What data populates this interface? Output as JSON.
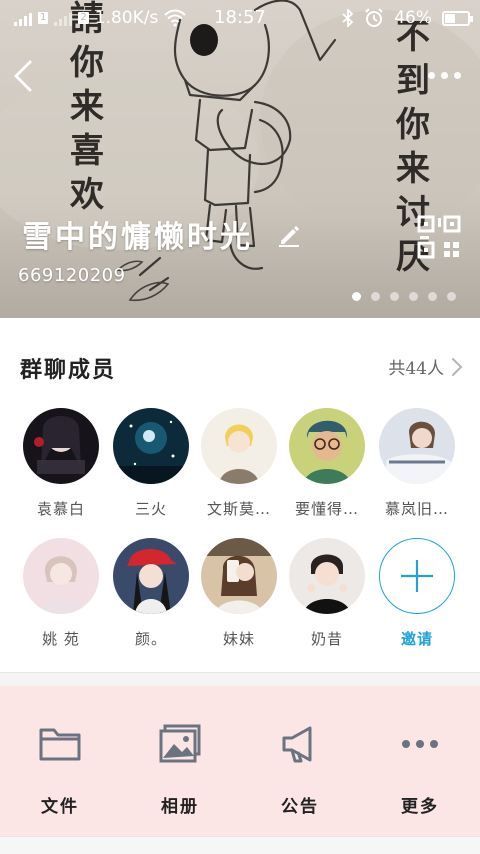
{
  "status_bar": {
    "network_speed": "1.80K/s",
    "time": "18:57",
    "battery": "46%",
    "battery_level": 0.46,
    "sim1": "1",
    "sim2": "2"
  },
  "header": {
    "group_name": "雪中的慵懒时光",
    "group_id": "669120209",
    "banner_pages": 6,
    "active_page": 0,
    "wall_text_left": "請你来喜欢",
    "wall_text_right": "不到你来讨厌"
  },
  "members": {
    "title": "群聊成员",
    "count_label": "共44人",
    "list": [
      {
        "name": "袁慕白",
        "avatar": "avatar-anime-girl-dark"
      },
      {
        "name": "三火",
        "avatar": "avatar-starry-sky"
      },
      {
        "name": "文斯莫…",
        "avatar": "avatar-anime-boy-blonde"
      },
      {
        "name": "要懂得…",
        "avatar": "avatar-painted-boy-glasses"
      },
      {
        "name": "慕岚旧…",
        "avatar": "avatar-girl-resting"
      },
      {
        "name": "姚 苑",
        "avatar": "avatar-girl-soft"
      },
      {
        "name": "颜。",
        "avatar": "avatar-girl-red-cap"
      },
      {
        "name": "妹妹",
        "avatar": "avatar-girl-phone"
      },
      {
        "name": "奶昔",
        "avatar": "avatar-child-peace"
      }
    ],
    "invite_label": "邀请"
  },
  "actions": [
    {
      "label": "文件",
      "icon": "folder-icon"
    },
    {
      "label": "相册",
      "icon": "album-icon"
    },
    {
      "label": "公告",
      "icon": "megaphone-icon"
    },
    {
      "label": "更多",
      "icon": "more-dots-icon"
    }
  ],
  "colors": {
    "accent": "#1fa3d8",
    "actions_bg": "#fbe5e5",
    "icon_gray": "#6b7380"
  }
}
